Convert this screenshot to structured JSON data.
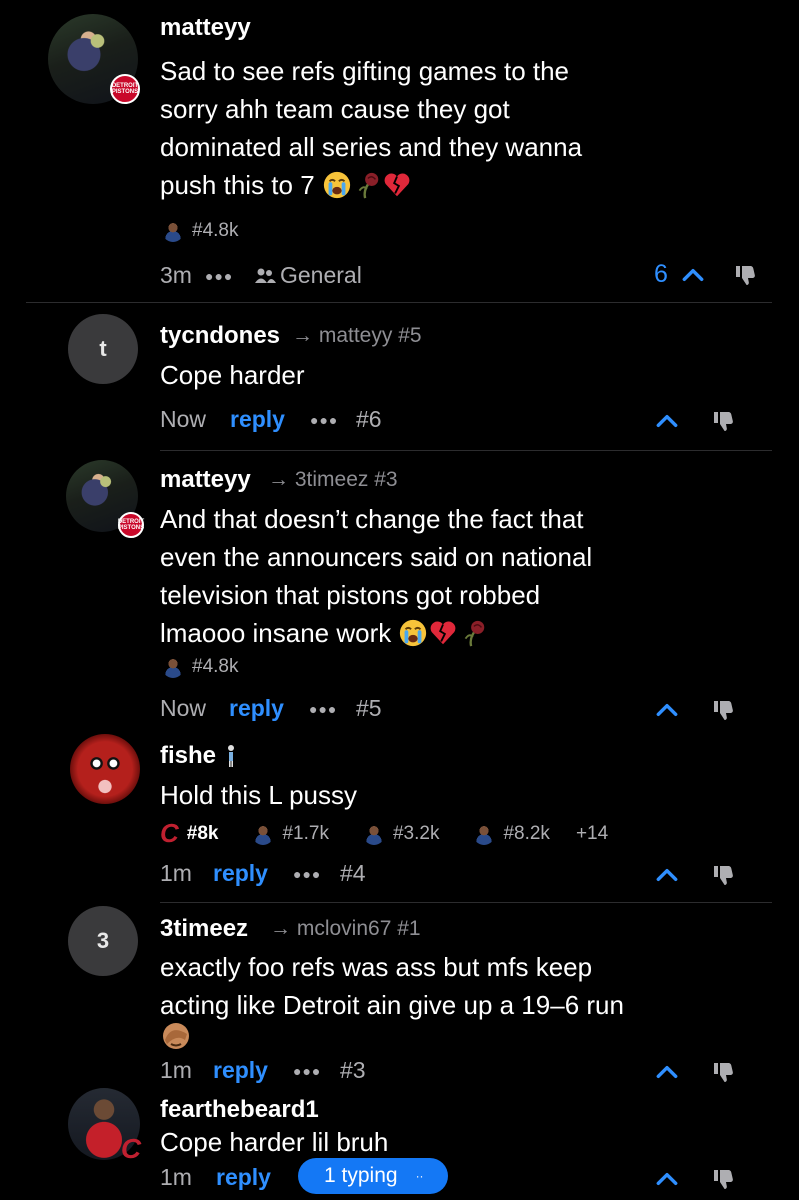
{
  "comments": [
    {
      "username": "matteyy",
      "body_lines": [
        "Sad to see refs gifting games to the",
        "sorry ahh team cause they got",
        "dominated all series and they wanna",
        "push this to 7"
      ],
      "flair": "#4.8k",
      "time": "3m",
      "channel": "General",
      "score": "6"
    },
    {
      "username": "tycndones",
      "avatar_letter": "t",
      "reply_to": "matteyy #5",
      "body_lines": [
        "Cope harder"
      ],
      "time": "Now",
      "reply_label": "reply",
      "number": "#6"
    },
    {
      "username": "matteyy",
      "reply_to": "3timeez #3",
      "body_lines": [
        "And that doesn’t change the fact that",
        "even the announcers said on national",
        "television that pistons got robbed",
        "lmaooo insane work"
      ],
      "flair": "#4.8k",
      "time": "Now",
      "reply_label": "reply",
      "number": "#5"
    },
    {
      "username": "fishe",
      "body_lines": [
        "Hold this L pussy"
      ],
      "flairs": [
        "#8k",
        "#1.7k",
        "#3.2k",
        "#8.2k"
      ],
      "flair_more": "+14",
      "time": "1m",
      "reply_label": "reply",
      "number": "#4"
    },
    {
      "username": "3timeez",
      "avatar_letter": "3",
      "reply_to": "mclovin67 #1",
      "body_lines": [
        "exactly foo refs was ass but mfs keep",
        "acting like Detroit ain give up a 19–6 run"
      ],
      "time": "1m",
      "reply_label": "reply",
      "number": "#3"
    },
    {
      "username": "fearthebeard1",
      "body_lines": [
        "Cope harder lil bruh"
      ],
      "time": "1m",
      "reply_label": "reply"
    }
  ],
  "typing_indicator": "1 typing",
  "badge_text": "DETROIT PISTONS",
  "colors": {
    "background": "#000000",
    "accent": "#2f8fff",
    "muted": "#aeaeb2",
    "typing": "#1478f5"
  },
  "icons": [
    "upvote-chevron-icon",
    "downvote-thumb-icon",
    "more-dots-icon",
    "group-icon",
    "reply-arrow-icon",
    "loudly-crying-emoji",
    "wilted-rose-emoji",
    "broken-heart-emoji",
    "facepalm-emoji"
  ]
}
